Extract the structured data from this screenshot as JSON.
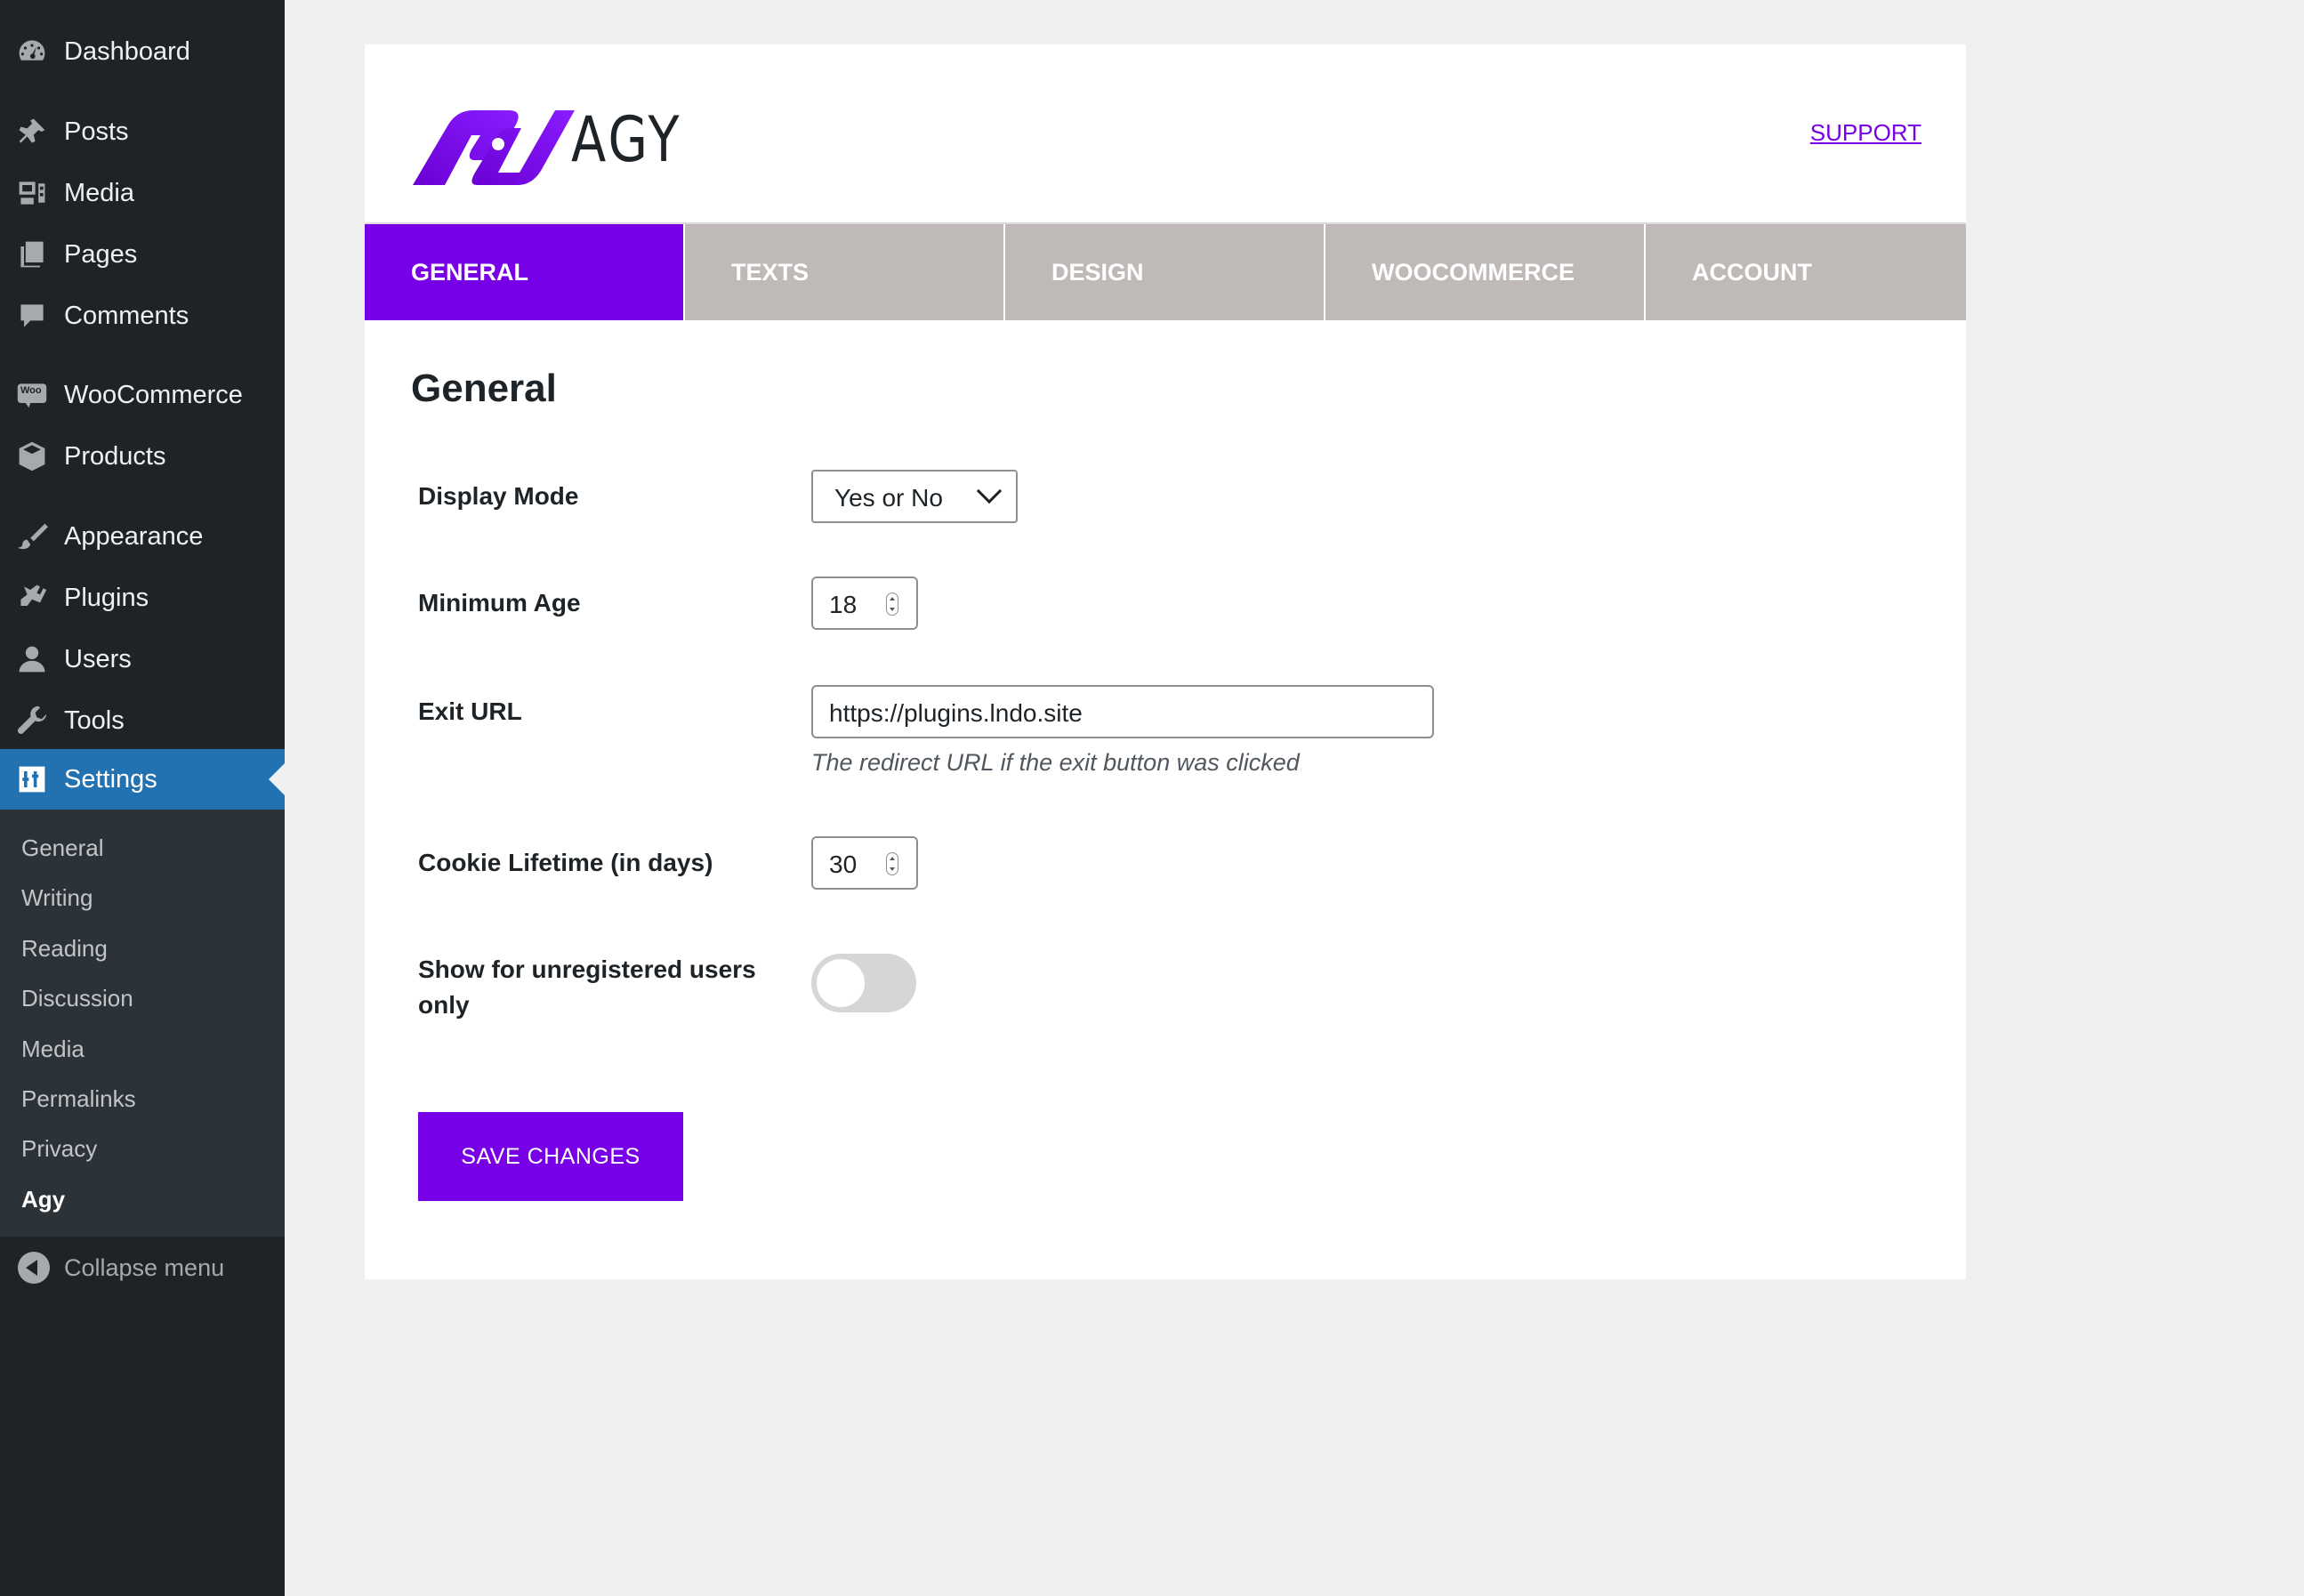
{
  "sidebar": {
    "items": [
      {
        "label": "Dashboard",
        "icon": "dashboard-icon"
      },
      {
        "label": "Posts",
        "icon": "pushpin-icon"
      },
      {
        "label": "Media",
        "icon": "media-icon"
      },
      {
        "label": "Pages",
        "icon": "pages-icon"
      },
      {
        "label": "Comments",
        "icon": "comment-bubble-icon"
      },
      {
        "label": "WooCommerce",
        "icon": "woocommerce-icon"
      },
      {
        "label": "Products",
        "icon": "box-icon"
      },
      {
        "label": "Appearance",
        "icon": "paintbrush-icon"
      },
      {
        "label": "Plugins",
        "icon": "plug-icon"
      },
      {
        "label": "Users",
        "icon": "user-icon"
      },
      {
        "label": "Tools",
        "icon": "wrench-icon"
      },
      {
        "label": "Settings",
        "icon": "sliders-icon",
        "current": true
      }
    ],
    "woo_badge": "Woo",
    "submenu": [
      "General",
      "Writing",
      "Reading",
      "Discussion",
      "Media",
      "Permalinks",
      "Privacy",
      "Agy"
    ],
    "submenu_current": "Agy",
    "collapse_label": "Collapse menu"
  },
  "header": {
    "logo_text": "AGY",
    "support_link": "SUPPORT"
  },
  "tabs": [
    {
      "label": "GENERAL",
      "active": true
    },
    {
      "label": "TEXTS",
      "active": false
    },
    {
      "label": "DESIGN",
      "active": false
    },
    {
      "label": "WOOCOMMERCE",
      "active": false
    },
    {
      "label": "ACCOUNT",
      "active": false
    }
  ],
  "section_title": "General",
  "form": {
    "display_mode": {
      "label": "Display Mode",
      "value": "Yes or No"
    },
    "minimum_age": {
      "label": "Minimum Age",
      "value": "18"
    },
    "exit_url": {
      "label": "Exit URL",
      "value": "https://plugins.lndo.site",
      "description": "The redirect URL if the exit button was clicked"
    },
    "cookie_lifetime": {
      "label": "Cookie Lifetime (in days)",
      "value": "30"
    },
    "unregistered_only": {
      "label_line1": "Show for unregistered users",
      "label_line2": "only",
      "checked": false
    }
  },
  "save_button": "SAVE CHANGES",
  "colors": {
    "brand_purple": "#7700e6",
    "sidebar_bg": "#1d2327",
    "submenu_bg": "#2c3338",
    "current_menu_blue": "#2271b1",
    "inactive_tab": "#bfbab8"
  }
}
